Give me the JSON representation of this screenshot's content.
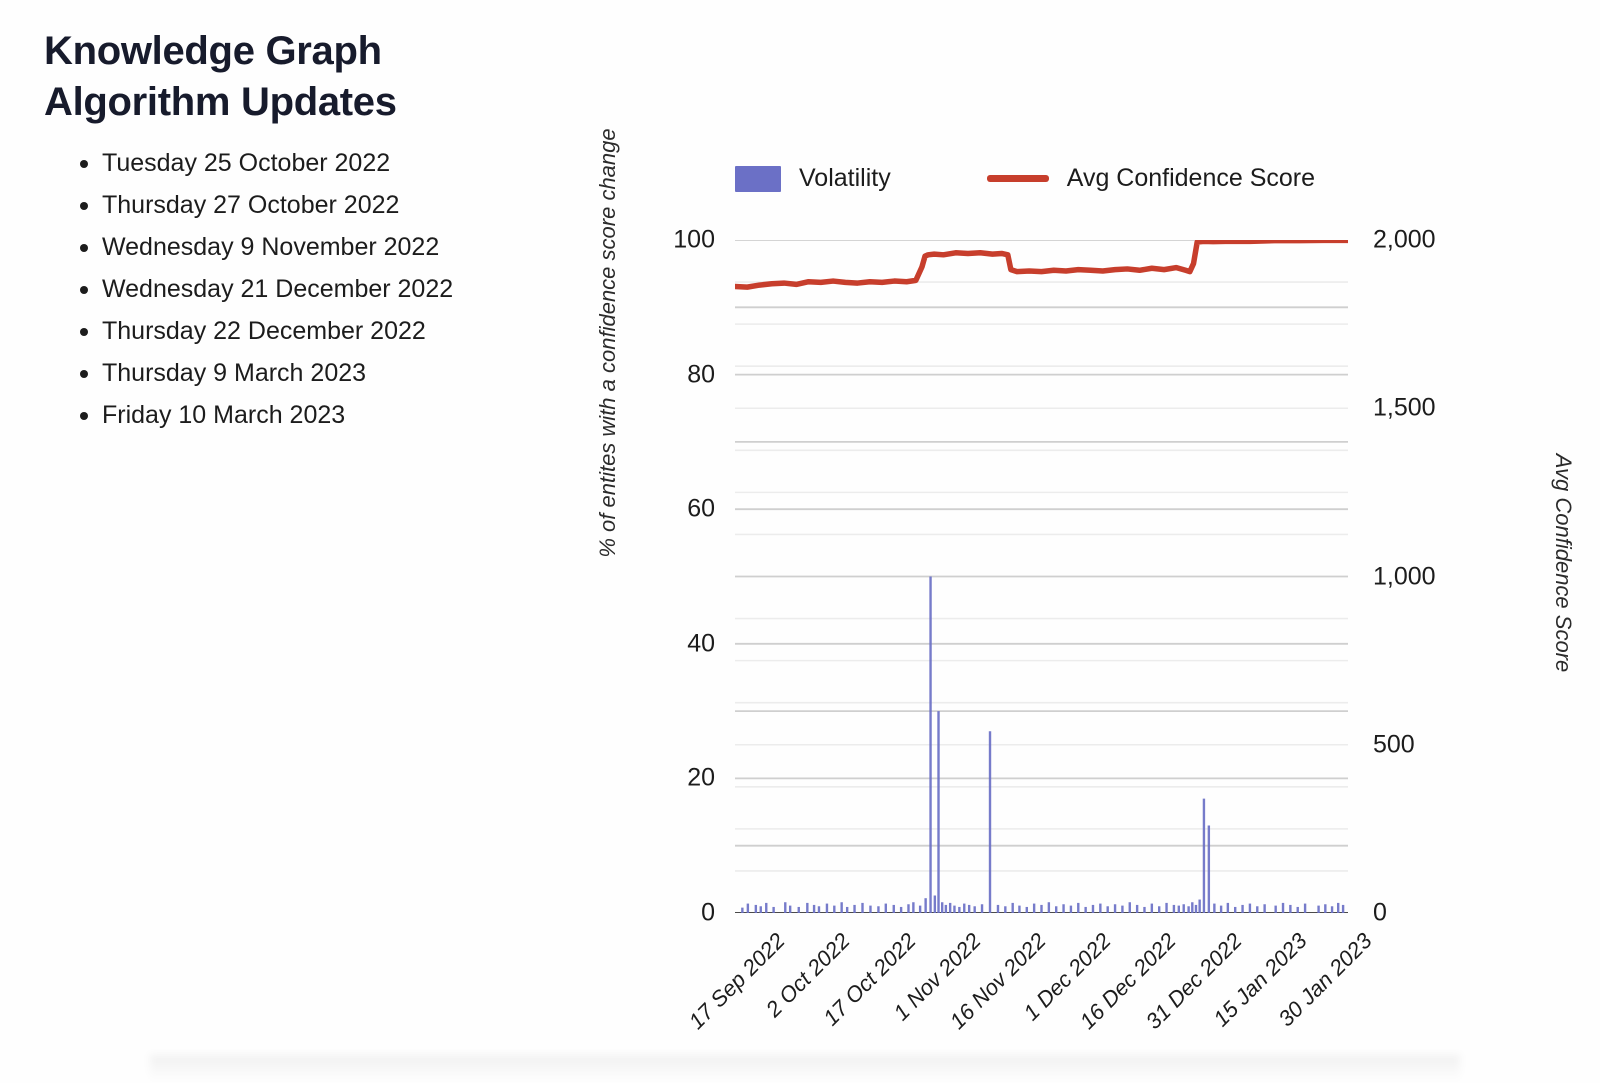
{
  "slide": {
    "title": "Knowledge Graph\nAlgorithm Updates",
    "title_color": "#171b2c",
    "background": "#fefefe"
  },
  "updates": {
    "items": [
      "Tuesday 25 October 2022",
      "Thursday 27 October 2022",
      "Wednesday 9 November 2022",
      "Wednesday 21 December 2022",
      "Thursday 22 December 2022",
      "Thursday 9 March 2023",
      "Friday 10 March 2023"
    ]
  },
  "legend": {
    "volatility_label": "Volatility",
    "confidence_label": "Avg Confidence Score",
    "volatility_color": "#6b70c6",
    "confidence_color": "#c73e2c"
  },
  "chart_data": {
    "type": "bar",
    "title": "",
    "subtitle": "",
    "xlabel": "",
    "ylabel": "% of entites with a confidence score change",
    "y2label": "Avg Confidence Score",
    "grid": true,
    "legend_position": "top",
    "x_tick_labels": [
      "17 Sep 2022",
      "2 Oct 2022",
      "17 Oct 2022",
      "1 Nov 2022",
      "16 Nov 2022",
      "1 Dec 2022",
      "16 Dec 2022",
      "31 Dec 2022",
      "15 Jan 2023",
      "30 Jan 2023"
    ],
    "x_tick_positions_pct": [
      0.5,
      11.1,
      21.8,
      32.4,
      43.0,
      53.7,
      64.3,
      75.0,
      85.6,
      96.2
    ],
    "ylim": [
      0,
      100
    ],
    "y_ticks": [
      0,
      20,
      40,
      60,
      80,
      100
    ],
    "y_tick_labels": [
      "0",
      "20",
      "40",
      "60",
      "80",
      "100"
    ],
    "y_minor_step": 10,
    "y2lim": [
      0,
      2000
    ],
    "y2_ticks": [
      0,
      500,
      1000,
      1500,
      2000
    ],
    "y2_tick_labels": [
      "0",
      "500",
      "1,000",
      "1,500",
      "2,000"
    ],
    "y2_minor_step": 125,
    "series": [
      {
        "name": "Volatility",
        "type": "bar",
        "axis": "left",
        "color": "#6b70c6",
        "x_pct": [
          1.2,
          2.1,
          3.4,
          4.2,
          5.1,
          6.3,
          8.2,
          9.0,
          10.4,
          11.8,
          12.9,
          13.7,
          15.0,
          16.2,
          17.4,
          18.3,
          19.5,
          20.8,
          22.1,
          23.4,
          24.6,
          25.9,
          27.1,
          28.3,
          29.1,
          30.2,
          31.1,
          31.9,
          32.6,
          33.2,
          33.8,
          34.4,
          35.1,
          35.8,
          36.6,
          37.4,
          38.2,
          39.1,
          40.3,
          41.6,
          42.9,
          44.1,
          45.3,
          46.4,
          47.6,
          48.8,
          50.0,
          51.2,
          52.4,
          53.6,
          54.8,
          56.0,
          57.2,
          58.4,
          59.6,
          60.8,
          62.0,
          63.2,
          64.4,
          65.6,
          66.8,
          68.0,
          69.2,
          70.4,
          71.6,
          72.4,
          73.2,
          74.0,
          74.6,
          75.2,
          75.8,
          76.5,
          77.3,
          78.2,
          79.3,
          80.4,
          81.6,
          82.8,
          84.0,
          85.2,
          86.4,
          88.2,
          89.4,
          90.6,
          91.8,
          93.0,
          95.2,
          96.3,
          97.4,
          98.4,
          99.2
        ],
        "values": [
          0.8,
          1.4,
          1.2,
          1.0,
          1.5,
          0.9,
          1.6,
          1.1,
          0.9,
          1.5,
          1.2,
          1.0,
          1.4,
          1.1,
          1.6,
          0.9,
          1.2,
          1.5,
          1.1,
          1.0,
          1.4,
          1.2,
          0.9,
          1.3,
          1.6,
          1.1,
          2.2,
          50.0,
          2.6,
          30.0,
          1.6,
          1.2,
          1.5,
          1.1,
          0.9,
          1.4,
          1.2,
          1.0,
          1.3,
          27.0,
          1.2,
          1.0,
          1.5,
          1.1,
          0.9,
          1.4,
          1.2,
          1.6,
          1.0,
          1.3,
          1.1,
          1.5,
          0.9,
          1.2,
          1.4,
          1.0,
          1.3,
          1.1,
          1.6,
          1.2,
          0.9,
          1.4,
          1.0,
          1.5,
          1.2,
          1.1,
          1.3,
          1.0,
          1.6,
          1.2,
          2.0,
          17.0,
          13.0,
          1.4,
          1.1,
          1.5,
          0.9,
          1.2,
          1.4,
          1.0,
          1.3,
          1.1,
          1.5,
          1.2,
          0.9,
          1.4,
          1.1,
          1.3,
          1.0,
          1.5,
          1.2
        ]
      },
      {
        "name": "Avg Confidence Score",
        "type": "line",
        "axis": "right",
        "color": "#c73e2c",
        "x_pct": [
          0.0,
          2.0,
          4.0,
          6.0,
          8.0,
          10.0,
          12.0,
          14.0,
          16.0,
          18.0,
          20.0,
          22.0,
          24.0,
          26.0,
          28.0,
          29.5,
          30.5,
          31.0,
          31.5,
          32.5,
          34.0,
          36.0,
          38.0,
          40.0,
          42.0,
          43.5,
          44.5,
          45.0,
          46.0,
          48.0,
          50.0,
          52.0,
          54.0,
          56.0,
          58.0,
          60.0,
          62.0,
          64.0,
          66.0,
          68.0,
          70.0,
          72.0,
          73.5,
          74.2,
          74.8,
          75.4,
          76.5,
          78.0,
          80.0,
          84.0,
          88.0,
          92.0,
          96.0,
          100.0
        ],
        "values": [
          1862,
          1860,
          1866,
          1870,
          1872,
          1868,
          1876,
          1874,
          1878,
          1874,
          1872,
          1876,
          1874,
          1878,
          1876,
          1880,
          1920,
          1952,
          1956,
          1958,
          1956,
          1962,
          1960,
          1962,
          1958,
          1960,
          1956,
          1912,
          1906,
          1908,
          1906,
          1910,
          1908,
          1912,
          1910,
          1908,
          1912,
          1914,
          1910,
          1916,
          1912,
          1918,
          1910,
          1906,
          1930,
          1994,
          1996,
          1995,
          1996,
          1996,
          1998,
          1998,
          1999,
          1999
        ]
      }
    ]
  }
}
